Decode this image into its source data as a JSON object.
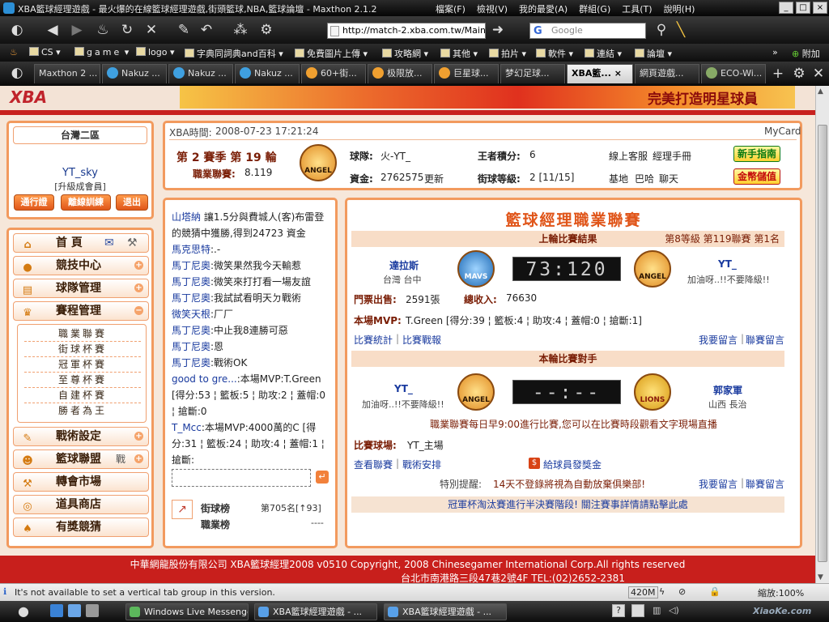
{
  "browser": {
    "title": "XBA籃球經理遊戲 - 最火爆的在線籃球經理遊戲,街頭籃球,NBA,籃球論壇 - Maxthon 2.1.2",
    "menu": [
      "檔案(F)",
      "檢視(V)",
      "我的最愛(A)",
      "群組(G)",
      "工具(T)",
      "說明(H)"
    ],
    "url": "http://match-2.xba.com.tw/Main",
    "search_placeholder": "Google",
    "favorites": [
      "CS",
      "game",
      "logo",
      "字典同詞典and百科",
      "免費圖片上傳",
      "攻略網",
      "其他",
      "拍片",
      "軟件",
      "連結",
      "論壇"
    ],
    "favorites_extra": "附加",
    "tabs": [
      "Maxthon 2 ...",
      "Nakuz ...",
      "Nakuz ...",
      "Nakuz ...",
      "60+街...",
      "极限放...",
      "巨星球...",
      "梦幻足球...",
      "XBA籃...",
      "網頁遊戲...",
      "ECO-Wi..."
    ],
    "active_tab_index": 8,
    "status_text": "It's not available to set a vertical tab group in this version.",
    "memory": "420M",
    "zoom": "縮放:100%"
  },
  "banner": {
    "slogan": "完美打造明星球員"
  },
  "user": {
    "region": "台灣二區",
    "name": "YT_sky",
    "upgrade": "[升級成會員]",
    "buttons": [
      "通行證",
      "離線訓練",
      "退出"
    ]
  },
  "menu": {
    "items": [
      {
        "label": "首 頁",
        "icon": "home-icon",
        "glyph": "⌂"
      },
      {
        "label": "競技中心",
        "icon": "basketball-icon",
        "glyph": "●"
      },
      {
        "label": "球隊管理",
        "icon": "clipboard-icon",
        "glyph": "▤"
      },
      {
        "label": "賽程管理",
        "icon": "trophy-icon",
        "glyph": "♛"
      },
      {
        "label": "戰術設定",
        "icon": "tactics-icon",
        "glyph": "✎"
      },
      {
        "label": "籃球聯盟",
        "icon": "people-icon",
        "glyph": "☻"
      },
      {
        "label": "轉會市場",
        "icon": "hammer-icon",
        "glyph": "⚒"
      },
      {
        "label": "道具商店",
        "icon": "coins-icon",
        "glyph": "◎"
      },
      {
        "label": "有獎競猜",
        "icon": "spade-icon",
        "glyph": "♠"
      }
    ],
    "home_extra_1": "✉",
    "home_extra_2": "⚒",
    "league_extra": "戰",
    "subitems": [
      "職業聯賽",
      "街球杯賽",
      "冠軍杯賽",
      "至尊杯賽",
      "自建杯賽",
      "勝者為王"
    ]
  },
  "info": {
    "xba_time_label": "XBA時間:",
    "xba_time": "2008-07-23 17:21:24",
    "mycard": "MyCard",
    "season": "第 2 賽季 第 19 輪",
    "league_label": "職業聯賽:",
    "league_value": "8.119",
    "team_label": "球隊:",
    "team": "火-YT_",
    "points_label": "王者積分:",
    "points": "6",
    "funds_label": "資金:",
    "funds": "2762575",
    "update": "更新",
    "level_label": "街球等級:",
    "level": "2 [11/15]",
    "service_links": [
      "線上客服",
      "經理手冊"
    ],
    "base_links": [
      "基地",
      "巴哈",
      "聊天"
    ],
    "btn_guide": "新手指南",
    "btn_coins": "金幣儲值",
    "team_badge": "ANGEL"
  },
  "chat": [
    {
      "name": "山塔納",
      "text": " 讓1.5分與費城人(客)布雷登的競猜中獲勝,得到24723 資金"
    },
    {
      "name": "馬克思特",
      "text": ":.-"
    },
    {
      "name": "馬丁尼奧",
      "text": ":微笑果然我今天輸惹"
    },
    {
      "name": "馬丁尼奧",
      "text": ":微笑來打打看一場友誼"
    },
    {
      "name": "馬丁尼奧",
      "text": ":我試試看明天ㄉ戰術"
    },
    {
      "name": "微笑天根",
      "text": ":厂厂"
    },
    {
      "name": "馬丁尼奧",
      "text": ":中止我8連勝可惡"
    },
    {
      "name": "馬丁尼奧",
      "text": ":恩"
    },
    {
      "name": "馬丁尼奧",
      "text": ":戰術OK"
    },
    {
      "name": "good to gre...",
      "text": ":本場MVP:T.Green [得分:53 ¦ 籃板:5 ¦ 助攻:2 ¦ 蓋帽:0 ¦ 搶斷:0"
    },
    {
      "name": "T_Mcc",
      "text": ":本場MVP:4000萬的C [得分:31 ¦ 籃板:24 ¦ 助攻:4 ¦ 蓋帽:1 ¦ 搶斷:"
    }
  ],
  "rank": {
    "street_label": "街球榜",
    "street_value": "第705名[↑93]",
    "league_label": "職業榜",
    "league_value": "----"
  },
  "match": {
    "title": "籃球經理職業聯賽",
    "last_header": "上輪比賽結果",
    "last_meta": "第8等級 第119聯賽 第1名",
    "home_team": "達拉斯",
    "home_loc": "台灣 台中",
    "home_badge": "MAVS",
    "score": "73:120",
    "away_team": "YT_",
    "away_motto": "加油呀..!!不要降級!!",
    "away_badge": "ANGEL",
    "tickets_label": "門票出售:",
    "tickets": "2591張",
    "income_label": "總收入:",
    "income": "76630",
    "mvp_label": "本場MVP:",
    "mvp": "T.Green [得分:39 ¦ 籃板:4 ¦ 助攻:4 ¦ 蓋帽:0 ¦ 搶斷:1]",
    "links_left": [
      "比賽統計",
      "比賽戰報"
    ],
    "links_right": [
      "我要留言",
      "聯賽留言"
    ],
    "next_header": "本輪比賽對手",
    "next_home": "YT_",
    "next_home_motto": "加油呀..!!不要降級!!",
    "next_home_badge": "ANGEL",
    "next_score": "--:--",
    "next_away": "郭家軍",
    "next_away_loc": "山西 長治",
    "next_away_badge": "LIONS",
    "schedule_note": "職業聯賽每日早9:00進行比賽,您可以在比賽時段觀看文字現場直播",
    "venue_label": "比賽球場:",
    "venue": "YT_主場",
    "links2_left": [
      "查看聯賽",
      "戰術安排"
    ],
    "bonus_link": "給球員發獎金",
    "reminder_label": "特別提醒:",
    "reminder": "14天不登錄將視為自動放棄俱樂部!",
    "links2_right": [
      "我要留言",
      "聯賽留言"
    ],
    "cup_notice": "冠軍杯淘汰賽進行半決賽階段! 關注賽事詳情請點擊此處"
  },
  "footer": {
    "line1": "中華網龍股份有限公司 XBA籃球經理2008 v0510   Copyright, 2008 Chinesegamer International Corp.All rights reserved",
    "line2": "台北市南港路三段47巷2號4F TEL:(02)2652-2381"
  },
  "taskbar": {
    "items": [
      "Windows Live Messenger",
      "XBA籃球經理遊戲 - ...",
      "XBA籃球經理遊戲 - ..."
    ],
    "watermark": "XiaoKe.com"
  },
  "colors": {
    "accent_orange": "#f29a5e",
    "brand_red": "#c81f1c",
    "link_blue": "#1a3b9f"
  }
}
